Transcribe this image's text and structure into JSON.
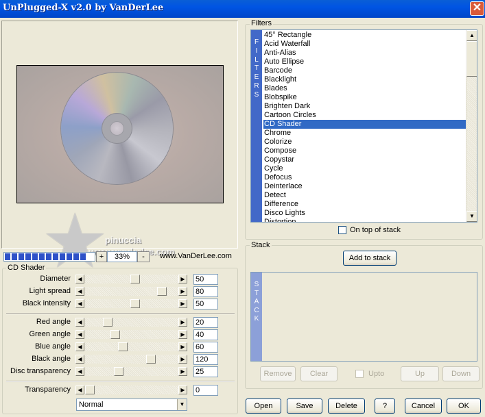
{
  "window": {
    "title": "UnPlugged-X v2.0 by VanDerLee",
    "close_icon": "close-icon"
  },
  "preview": {
    "zoom_plus": "+",
    "zoom_value": "33%",
    "zoom_minus": "-",
    "website": "www.VanDerLee.com",
    "watermark_line1": "pinuccia",
    "watermark_line2": "www.vanderlee.com"
  },
  "cd_shader": {
    "group_label": "CD Shader",
    "params": [
      {
        "label": "Diameter",
        "value": "50",
        "position": 0.5
      },
      {
        "label": "Light spread",
        "value": "80",
        "position": 0.8
      },
      {
        "label": "Black intensity",
        "value": "50",
        "position": 0.5
      }
    ],
    "angles": [
      {
        "label": "Red angle",
        "value": "20",
        "position": 0.2
      },
      {
        "label": "Green angle",
        "value": "40",
        "position": 0.28
      },
      {
        "label": "Blue angle",
        "value": "60",
        "position": 0.37
      },
      {
        "label": "Black angle",
        "value": "120",
        "position": 0.68
      },
      {
        "label": "Disc transparency",
        "value": "25",
        "position": 0.32
      }
    ],
    "transparency": {
      "label": "Transparency",
      "value": "0",
      "position": 0.0
    },
    "blend_mode": "Normal"
  },
  "filters": {
    "group_label": "Filters",
    "side_label": [
      "F",
      "I",
      "L",
      "T",
      "E",
      "R",
      "S"
    ],
    "items": [
      "45° Rectangle",
      "Acid Waterfall",
      "Anti-Alias",
      "Auto Ellipse",
      "Barcode",
      "Blacklight",
      "Blades",
      "Blobspike",
      "Brighten Dark",
      "Cartoon Circles",
      "CD Shader",
      "Chrome",
      "Colorize",
      "Compose",
      "Copystar",
      "Cycle",
      "Defocus",
      "Deinterlace",
      "Detect",
      "Difference",
      "Disco Lights",
      "Distortion"
    ],
    "selected_index": 10,
    "on_top_label": "On top of stack"
  },
  "stack": {
    "group_label": "Stack",
    "add_button": "Add to stack",
    "side_label": [
      "S",
      "T",
      "A",
      "C",
      "K"
    ],
    "remove": "Remove",
    "clear": "Clear",
    "upto": "Upto",
    "up": "Up",
    "down": "Down"
  },
  "footer": {
    "open": "Open",
    "save": "Save",
    "delete": "Delete",
    "help": "?",
    "cancel": "Cancel",
    "ok": "OK"
  },
  "colors": {
    "title_blue": "#0054e3",
    "selection": "#316ac5",
    "strip_blue": "#4269c8",
    "progress": "#2f52c8"
  }
}
